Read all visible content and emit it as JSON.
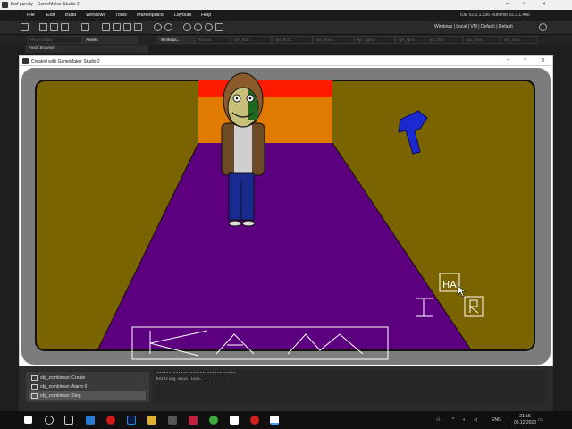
{
  "ide": {
    "title": "fnaf parody - GameMaker Studio 2",
    "menu": [
      "File",
      "Edit",
      "Build",
      "Windows",
      "Tools",
      "Marketplace",
      "Layouts",
      "Help"
    ],
    "version_info": "IDE v2.3.1.536  Runtime v2.3.1.406",
    "layout_info": "Windows | Local | VM | Default | Default",
    "tabs": [
      "Room Editor",
      "Assets",
      "Workspa...",
      "Room1",
      "spr_butt...",
      "spr_butt...",
      "spr_door...",
      "spr_light...",
      "spr_light...",
      "spr_rbtn",
      "spr_zom...",
      "spr_zom..."
    ],
    "asset_browser": "Asset Browser"
  },
  "game_window": {
    "title": "Created with GameMaker Studio 2",
    "hud_text": "HAI"
  },
  "object_list": [
    "obj_zombiman: Create",
    "obj_zombiman: Alarm 0",
    "obj_zombiman: Step"
  ],
  "output_lines": [
    "*********************************",
    "Entering main loop.",
    "*********************************"
  ],
  "taskbar": {
    "language": "ENG",
    "time": "21:55",
    "date": "08.12.2020"
  },
  "colors": {
    "room_wall": "#7a6400",
    "room_floor": "#5c0080",
    "door_red": "#ff1a00",
    "door_orange": "#e07a00",
    "frame_gray": "#7c7c7c"
  }
}
